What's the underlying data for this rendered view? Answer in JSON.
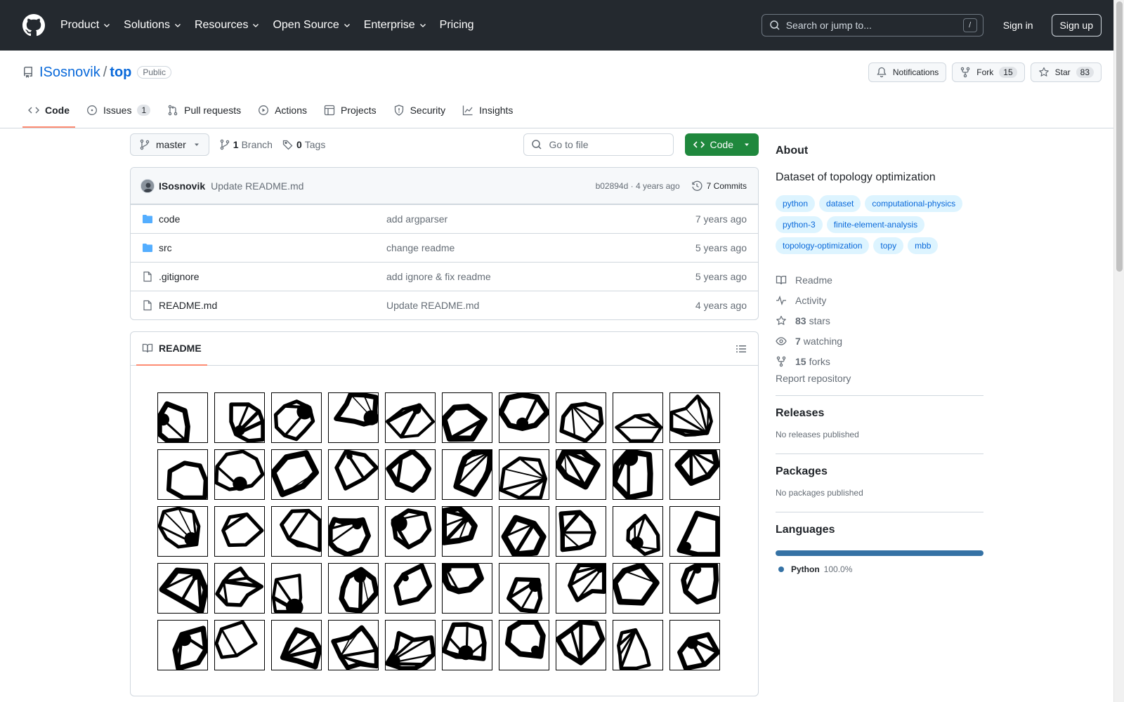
{
  "header": {
    "nav": [
      {
        "label": "Product"
      },
      {
        "label": "Solutions"
      },
      {
        "label": "Resources"
      },
      {
        "label": "Open Source"
      },
      {
        "label": "Enterprise"
      },
      {
        "label": "Pricing"
      }
    ],
    "search_placeholder": "Search or jump to...",
    "slash": "/",
    "signin": "Sign in",
    "signup": "Sign up"
  },
  "repo": {
    "owner": "ISosnovik",
    "sep": "/",
    "name": "top",
    "visibility": "Public",
    "notifications": "Notifications",
    "fork_label": "Fork",
    "fork_count": "15",
    "star_label": "Star",
    "star_count": "83"
  },
  "tabs": [
    {
      "label": "Code",
      "icon": "code-icon"
    },
    {
      "label": "Issues",
      "count": "1",
      "icon": "issue-icon"
    },
    {
      "label": "Pull requests",
      "icon": "pull-request-icon"
    },
    {
      "label": "Actions",
      "icon": "play-icon"
    },
    {
      "label": "Projects",
      "icon": "table-icon"
    },
    {
      "label": "Security",
      "icon": "shield-icon"
    },
    {
      "label": "Insights",
      "icon": "graph-icon"
    }
  ],
  "filenav": {
    "branch": "master",
    "branch_count": "1",
    "branch_label": "Branch",
    "tag_count": "0",
    "tag_label": "Tags",
    "goto_placeholder": "Go to file",
    "code_label": "Code"
  },
  "commit": {
    "author": "ISosnovik",
    "message": "Update README.md",
    "meta": "b02894d · 4 years ago",
    "commits": "7 Commits"
  },
  "files": [
    {
      "name": "code",
      "type": "folder",
      "message": "add argparser",
      "age": "7 years ago"
    },
    {
      "name": "src",
      "type": "folder",
      "message": "change readme",
      "age": "5 years ago"
    },
    {
      "name": ".gitignore",
      "type": "file",
      "message": "add ignore & fix readme",
      "age": "5 years ago"
    },
    {
      "name": "README.md",
      "type": "file",
      "message": "Update README.md",
      "age": "4 years ago"
    }
  ],
  "readme": {
    "title": "README"
  },
  "about": {
    "title": "About",
    "description": "Dataset of topology optimization",
    "topics": [
      "python",
      "dataset",
      "computational-physics",
      "python-3",
      "finite-element-analysis",
      "topology-optimization",
      "topy",
      "mbb"
    ],
    "readme": "Readme",
    "activity": "Activity",
    "stars_count": "83",
    "stars_label": "stars",
    "watching_count": "7",
    "watching_label": "watching",
    "forks_count": "15",
    "forks_label": "forks",
    "report": "Report repository"
  },
  "releases": {
    "title": "Releases",
    "empty": "No releases published"
  },
  "packages": {
    "title": "Packages",
    "empty": "No packages published"
  },
  "languages": {
    "title": "Languages",
    "items": [
      {
        "name": "Python",
        "percent": "100.0%",
        "color": "#3572A5"
      }
    ]
  },
  "colors": {
    "accent": "#0969da",
    "primary_button": "#1f883d",
    "tab_underline": "#fd8c73"
  }
}
